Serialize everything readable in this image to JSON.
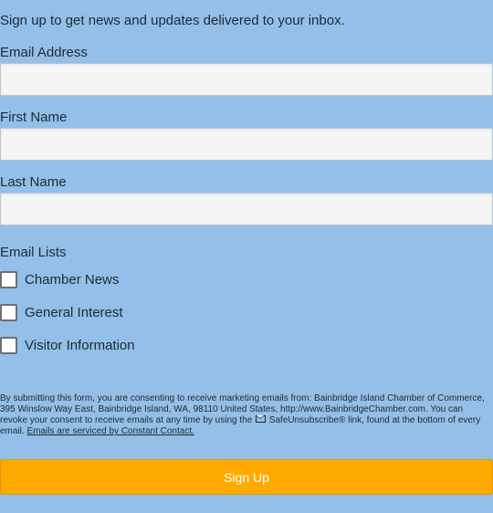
{
  "intro_text": "Sign up to get news and updates delivered to your inbox.",
  "fields": {
    "email": {
      "label": "Email Address",
      "value": ""
    },
    "first_name": {
      "label": "First Name",
      "value": ""
    },
    "last_name": {
      "label": "Last Name",
      "value": ""
    }
  },
  "lists": {
    "label": "Email Lists",
    "items": [
      {
        "label": "Chamber News",
        "checked": false
      },
      {
        "label": "General Interest",
        "checked": false
      },
      {
        "label": "Visitor Information",
        "checked": false
      }
    ]
  },
  "consent": {
    "text_1": "By submitting this form, you are consenting to receive marketing emails from: Bainbridge Island Chamber of Commerce, 395 Winslow Way East, Bainbridge Island, WA, 98110 United States, http://www.BainbridgeChamber.com. You can revoke your consent to receive emails at any time by using the",
    "text_2": "SafeUnsubscribe® link, found at the bottom of every email.",
    "link": "Emails are serviced by Constant Contact.",
    "icon": "envelope-icon"
  },
  "signup_label": "Sign Up",
  "colors": {
    "background": "#93bfe8",
    "button": "#ffaa00"
  }
}
